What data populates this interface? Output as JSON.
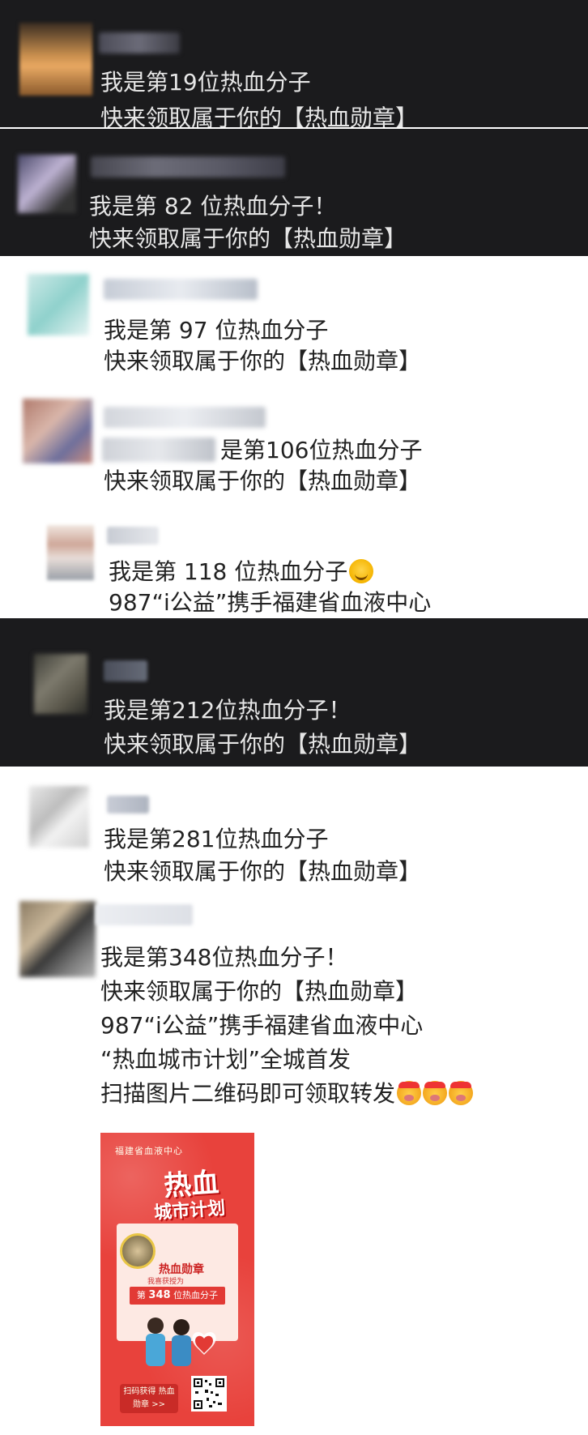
{
  "posts": [
    {
      "line1": "我是第19位热血分子",
      "line2": "快来领取属于你的【热血勋章】"
    },
    {
      "line1": "我是第 82 位热血分子！",
      "line2": "快来领取属于你的【热血勋章】"
    },
    {
      "line1": "我是第 97 位热血分子",
      "line2": "快来领取属于你的【热血勋章】"
    },
    {
      "line1": "是第106位热血分子",
      "line2": "快来领取属于你的【热血勋章】"
    },
    {
      "line1": "我是第 118 位热血分子",
      "line2": "987“i公益”携手福建省血液中心"
    },
    {
      "line1": "我是第212位热血分子！",
      "line2": "快来领取属于你的【热血勋章】"
    },
    {
      "line1": "我是第281位热血分子",
      "line2": "快来领取属于你的【热血勋章】"
    },
    {
      "lines": [
        "我是第348位热血分子！",
        "快来领取属于你的【热血勋章】",
        "987“i公益”携手福建省血液中心",
        "“热血城市计划”全城首发",
        "扫描图片二维码即可领取转发"
      ]
    }
  ],
  "poster": {
    "header": "福建省血液中心",
    "title1": "热血",
    "title2": "城市计划",
    "medal": "热血勋章",
    "pre": "我喜获授为",
    "rank_prefix": "第",
    "rank_number": "348",
    "rank_suffix": "位热血分子",
    "button": "扫码获得 热血勋章 >>"
  },
  "colors": {
    "dark_bg": "#1b1b1d",
    "light_bg": "#ffffff",
    "poster_red": "#e8423c"
  }
}
